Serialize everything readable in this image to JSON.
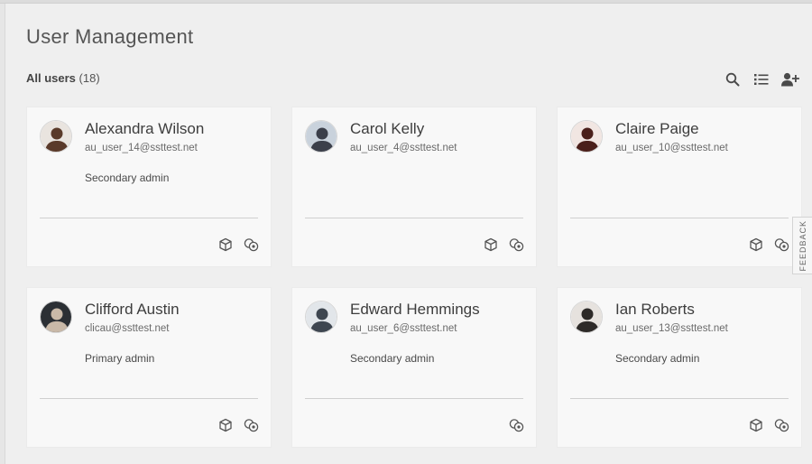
{
  "header": {
    "title": "User Management",
    "users_label": "All users",
    "users_count": "(18)"
  },
  "toolbar": {
    "icons": [
      "search-icon",
      "list-view-icon",
      "add-user-icon"
    ]
  },
  "colors": {
    "background": "#efefef",
    "card": "#f8f8f8",
    "text": "#3c3c3c",
    "divider": "#cfcfcf"
  },
  "users": [
    {
      "name": "Alexandra Wilson",
      "email": "au_user_14@ssttest.net",
      "role": "Secondary admin",
      "avatar_bg": "#e9e4df",
      "avatar_fg": "#5a3a2a"
    },
    {
      "name": "Carol Kelly",
      "email": "au_user_4@ssttest.net",
      "role": "",
      "avatar_bg": "#c9d2dc",
      "avatar_fg": "#3b3f4a"
    },
    {
      "name": "Claire Paige",
      "email": "au_user_10@ssttest.net",
      "role": "",
      "avatar_bg": "#f1e6e2",
      "avatar_fg": "#4a1f1a"
    },
    {
      "name": "Clifford Austin",
      "email": "clicau@ssttest.net",
      "role": "Primary admin",
      "avatar_bg": "#2b2f34",
      "avatar_fg": "#c9b9a8"
    },
    {
      "name": "Edward Hemmings",
      "email": "au_user_6@ssttest.net",
      "role": "Secondary admin",
      "avatar_bg": "#e2e6ea",
      "avatar_fg": "#3e4650"
    },
    {
      "name": "Ian Roberts",
      "email": "au_user_13@ssttest.net",
      "role": "Secondary admin",
      "avatar_bg": "#e6e2de",
      "avatar_fg": "#2d2a28"
    }
  ],
  "feedback": {
    "label": "FEEDBACK"
  }
}
